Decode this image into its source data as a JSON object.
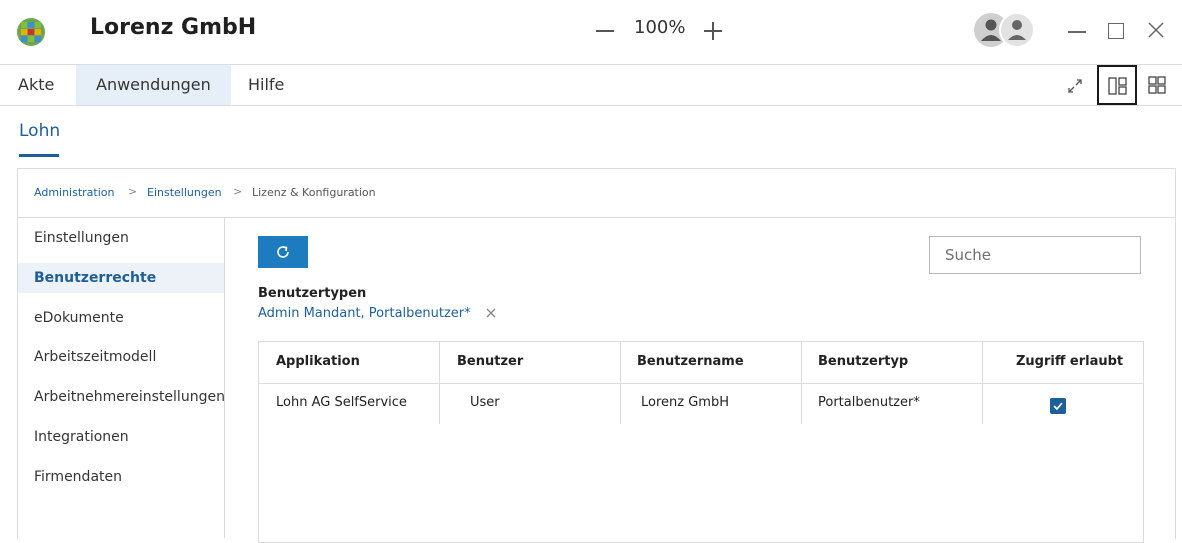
{
  "app": {
    "title": "Lorenz GmbH",
    "zoom": "100%"
  },
  "menu": {
    "items": [
      "Akte",
      "Anwendungen",
      "Hilfe"
    ]
  },
  "module": {
    "tab": "Lohn"
  },
  "breadcrumb": [
    "Administration",
    "Einstellungen",
    "Lizenz & Konfiguration"
  ],
  "sidebar": {
    "items": [
      "Einstellungen",
      "Benutzerrechte",
      "eDokumente",
      "Arbeitszeitmodell",
      "Arbeitnehmereinstellungen",
      "Integrationen",
      "Firmendaten"
    ],
    "active_index": 1
  },
  "search": {
    "placeholder": "Suche",
    "value": ""
  },
  "filter": {
    "title": "Benutzertypen",
    "value": "Admin Mandant, Portalbenutzer*"
  },
  "table": {
    "columns": [
      "Applikation",
      "Benutzer",
      "Benutzername",
      "Benutzertyp",
      "Zugriff erlaubt"
    ],
    "rows": [
      {
        "applikation": "Lohn AG SelfService",
        "benutzer": "User",
        "benutzername": "Lorenz GmbH",
        "benutzertyp": "Portalbenutzer*",
        "zugriff_erlaubt": true
      }
    ]
  },
  "colors": {
    "accent": "#1d5f9a",
    "button": "#1d7bbf",
    "active_bg": "#e6eef7"
  }
}
